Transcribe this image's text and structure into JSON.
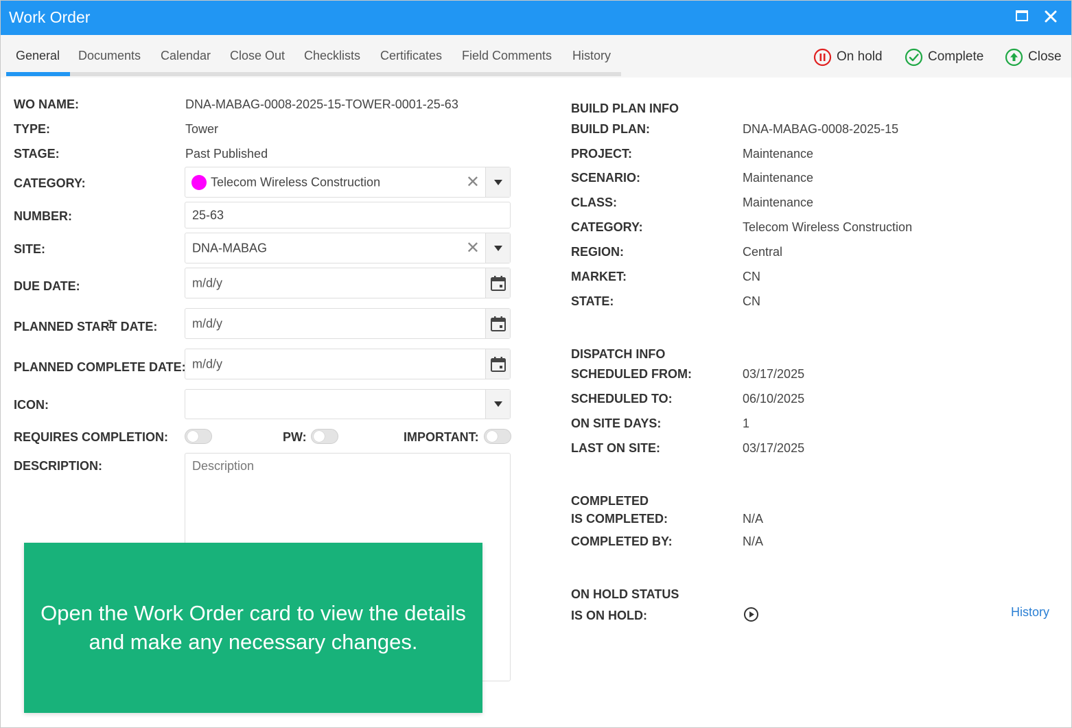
{
  "window": {
    "title": "Work Order"
  },
  "tabs": [
    {
      "label": "General"
    },
    {
      "label": "Documents"
    },
    {
      "label": "Calendar"
    },
    {
      "label": "Close Out"
    },
    {
      "label": "Checklists"
    },
    {
      "label": "Certificates"
    },
    {
      "label": "Field Comments"
    },
    {
      "label": "History"
    }
  ],
  "actions": {
    "on_hold": "On hold",
    "complete": "Complete",
    "close": "Close"
  },
  "form": {
    "wo_name": {
      "label": "WO NAME:",
      "value": "DNA-MABAG-0008-2025-15-TOWER-0001-25-63"
    },
    "type": {
      "label": "TYPE:",
      "value": "Tower"
    },
    "stage": {
      "label": "STAGE:",
      "value": "Past Published"
    },
    "category": {
      "label": "CATEGORY:",
      "value": "Telecom Wireless Construction",
      "color": "#ff00ff"
    },
    "number": {
      "label": "NUMBER:",
      "value": "25-63"
    },
    "site": {
      "label": "SITE:",
      "value": "DNA-MABAG"
    },
    "due_date": {
      "label": "DUE DATE:",
      "placeholder": "m/d/y"
    },
    "planned_start_date": {
      "label": "PLANNED START DATE:",
      "placeholder": "m/d/y"
    },
    "planned_complete_date": {
      "label": "PLANNED COMPLETE DATE:",
      "placeholder": "m/d/y"
    },
    "icon": {
      "label": "ICON:",
      "value": ""
    },
    "requires_completion": {
      "label": "REQUIRES COMPLETION:",
      "on": false
    },
    "pw": {
      "label": "PW:",
      "on": false
    },
    "important": {
      "label": "IMPORTANT:",
      "on": false
    },
    "description": {
      "label": "DESCRIPTION:",
      "placeholder": "Description"
    }
  },
  "build_plan_info": {
    "heading": "BUILD PLAN INFO",
    "rows": [
      {
        "label": "BUILD PLAN:",
        "value": "DNA-MABAG-0008-2025-15"
      },
      {
        "label": "PROJECT:",
        "value": "Maintenance"
      },
      {
        "label": "SCENARIO:",
        "value": "Maintenance"
      },
      {
        "label": "CLASS:",
        "value": "Maintenance"
      },
      {
        "label": "CATEGORY:",
        "value": "Telecom Wireless Construction"
      },
      {
        "label": "REGION:",
        "value": "Central"
      },
      {
        "label": "MARKET:",
        "value": "CN"
      },
      {
        "label": "STATE:",
        "value": "CN"
      }
    ]
  },
  "dispatch_info": {
    "heading": "DISPATCH INFO",
    "rows": [
      {
        "label": "SCHEDULED FROM:",
        "value": "03/17/2025"
      },
      {
        "label": "SCHEDULED TO:",
        "value": "06/10/2025"
      },
      {
        "label": "ON SITE DAYS:",
        "value": "1"
      },
      {
        "label": "LAST ON SITE:",
        "value": "03/17/2025"
      }
    ]
  },
  "completed": {
    "heading": "COMPLETED",
    "rows": [
      {
        "label": "IS COMPLETED:",
        "value": "N/A"
      },
      {
        "label": "COMPLETED BY:",
        "value": "N/A"
      }
    ]
  },
  "on_hold_status": {
    "heading": "ON HOLD STATUS",
    "is_on_hold_label": "IS ON HOLD:",
    "history_link": "History"
  },
  "overlay": {
    "message": "Open the Work Order card to view the details and make any necessary changes."
  },
  "colors": {
    "titlebar": "#2196f3",
    "overlay": "#18b27a",
    "on_hold": "#e02020",
    "complete": "#1fa845",
    "link": "#2a7fd4"
  }
}
